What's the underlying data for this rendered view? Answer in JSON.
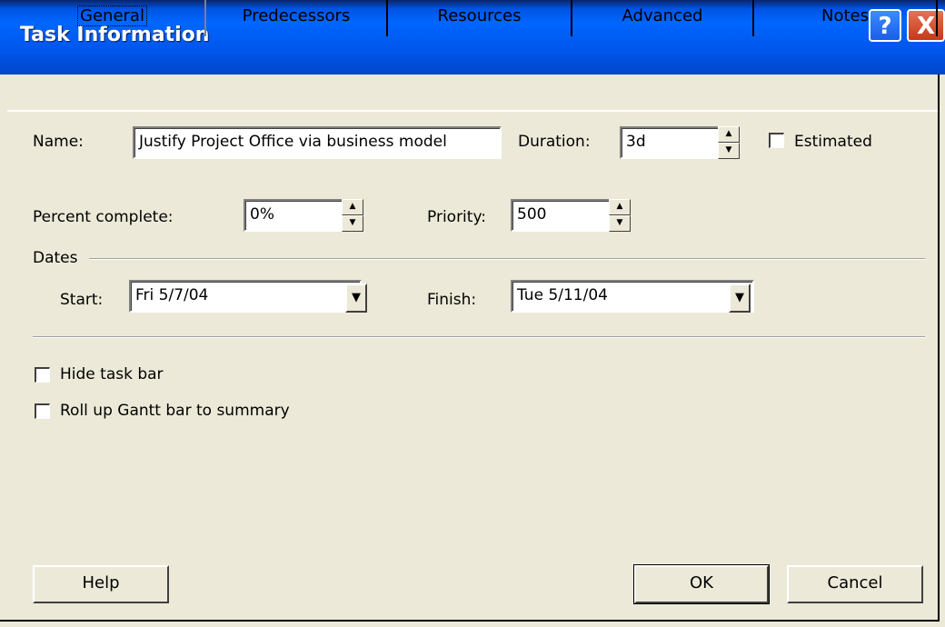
{
  "window": {
    "title": "Task Information",
    "help_glyph": "?",
    "close_glyph": "X"
  },
  "tabs": [
    {
      "label": "General",
      "active": true
    },
    {
      "label": "Predecessors"
    },
    {
      "label": "Resources"
    },
    {
      "label": "Advanced"
    },
    {
      "label": "Notes"
    }
  ],
  "general": {
    "name_label": "Name:",
    "name_value": "Justify Project Office via business model",
    "duration_label": "Duration:",
    "duration_value": "3d",
    "estimated_label": "Estimated",
    "estimated_checked": false,
    "percent_label": "Percent complete:",
    "percent_value": "0%",
    "priority_label": "Priority:",
    "priority_value": "500",
    "dates_group_label": "Dates",
    "start_label": "Start:",
    "start_value": "Fri 5/7/04",
    "finish_label": "Finish:",
    "finish_value": "Tue 5/11/04",
    "hide_taskbar_label": "Hide task bar",
    "hide_taskbar_checked": false,
    "rollup_label": "Roll up Gantt bar to summary",
    "rollup_checked": false
  },
  "buttons": {
    "help": "Help",
    "ok": "OK",
    "cancel": "Cancel"
  },
  "icons": {
    "spin_up": "up-arrow-icon",
    "spin_down": "down-arrow-icon",
    "dropdown": "dropdown-arrow-icon"
  },
  "colors": {
    "title_bar": "#0055ea",
    "dialog_bg": "#ece9d8",
    "close_button": "#c6391a"
  }
}
